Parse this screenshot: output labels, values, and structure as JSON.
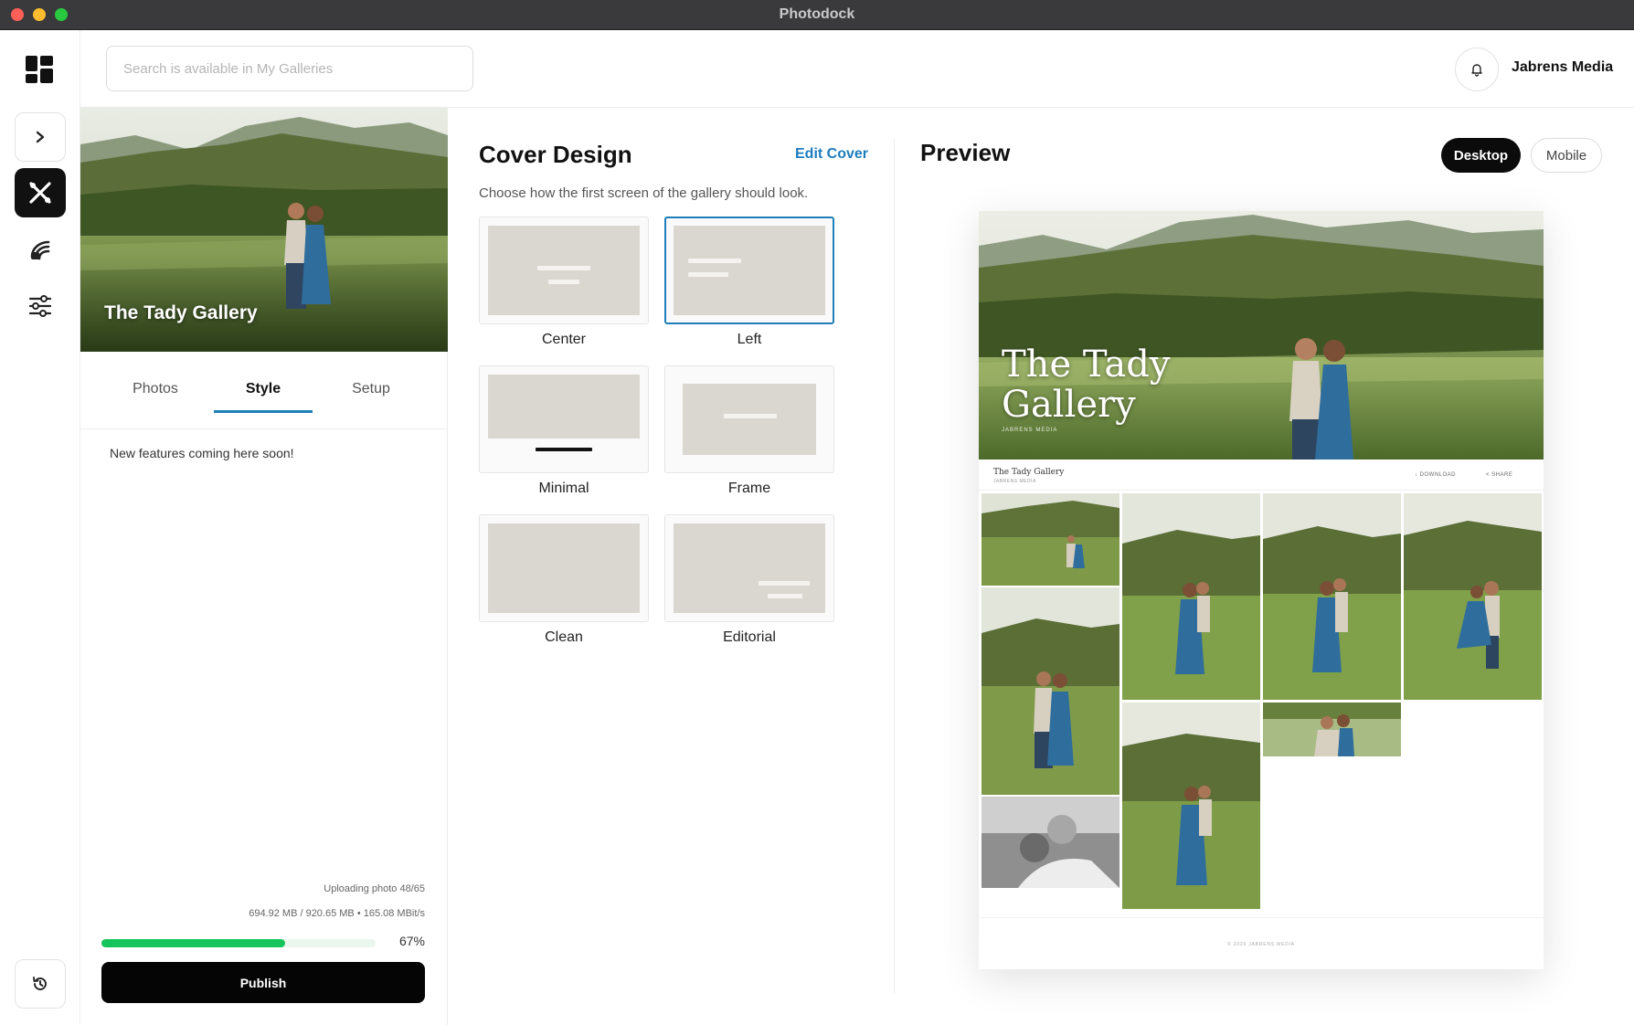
{
  "window": {
    "title": "Photodock"
  },
  "search": {
    "placeholder": "Search is available in My Galleries"
  },
  "account": {
    "name": "Jabrens Media"
  },
  "rail": {
    "items": [
      {
        "name": "dashboard",
        "icon": "dashboard-grid-icon"
      },
      {
        "name": "expand",
        "icon": "chevron-right-icon"
      },
      {
        "name": "design",
        "icon": "design-tools-icon",
        "active": true
      },
      {
        "name": "store",
        "icon": "layers-icon"
      },
      {
        "name": "settings",
        "icon": "sliders-icon"
      },
      {
        "name": "history",
        "icon": "history-icon"
      }
    ]
  },
  "gallery": {
    "name": "The Tady Gallery",
    "tabs": [
      {
        "label": "Photos"
      },
      {
        "label": "Style",
        "active": true
      },
      {
        "label": "Setup"
      }
    ],
    "notice": "New features coming here soon!"
  },
  "upload": {
    "status": "Uploading photo 48/65",
    "stats": "694.92 MB / 920.65 MB • 165.08 MBit/s",
    "progress_percent": 67,
    "progress_label": "67%",
    "publish_label": "Publish"
  },
  "cover_design": {
    "title": "Cover Design",
    "edit_label": "Edit Cover",
    "description": "Choose how the first screen of the gallery should look.",
    "options": [
      {
        "label": "Center",
        "selected": false
      },
      {
        "label": "Left",
        "selected": true
      },
      {
        "label": "Minimal",
        "selected": false
      },
      {
        "label": "Frame",
        "selected": false
      },
      {
        "label": "Clean",
        "selected": false
      },
      {
        "label": "Editorial",
        "selected": false
      }
    ]
  },
  "preview": {
    "title": "Preview",
    "modes": [
      {
        "label": "Desktop",
        "active": true
      },
      {
        "label": "Mobile",
        "active": false
      }
    ],
    "hero_title": "The Tady Gallery",
    "bar_title": "The Tady Gallery",
    "bar_subtitle": "JABRENS MEDIA",
    "download_label": "DOWNLOAD",
    "share_label": "SHARE",
    "footer": "© 2020 JABRENS MEDIA"
  },
  "colors": {
    "accent": "#1f7fb8",
    "progress": "#16c45c",
    "primary_button": "#050505",
    "option_placeholder": "#d9d7d0"
  }
}
